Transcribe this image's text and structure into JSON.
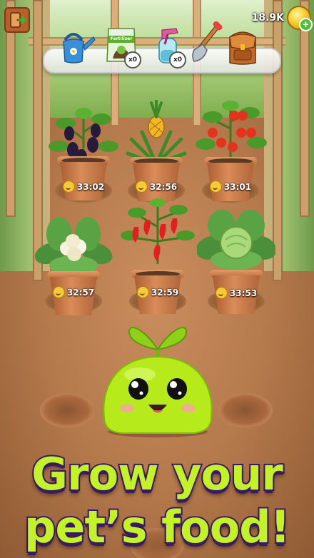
{
  "header": {
    "coins": "18.9K"
  },
  "tools": [
    {
      "name": "watering-can",
      "count": null
    },
    {
      "name": "fertilizer",
      "label": "Fertilizer",
      "count": "x0"
    },
    {
      "name": "spray-bottle",
      "count": "x0"
    },
    {
      "name": "shovel",
      "count": null
    },
    {
      "name": "backpack",
      "count": null
    }
  ],
  "plants": [
    {
      "name": "blackberry",
      "timer": "33:02"
    },
    {
      "name": "pineapple",
      "timer": "32:56"
    },
    {
      "name": "tomato",
      "timer": "33:01"
    },
    {
      "name": "cauliflower",
      "timer": "32:57"
    },
    {
      "name": "pepper",
      "timer": "32:59"
    },
    {
      "name": "cabbage",
      "timer": "33:53"
    }
  ],
  "title": {
    "line1": "Grow your",
    "line2": "pet’s food!"
  },
  "colors": {
    "title_fill": "#c4f22a",
    "title_outline": "#3a1a66",
    "pet_body": "#b6ea1a"
  }
}
